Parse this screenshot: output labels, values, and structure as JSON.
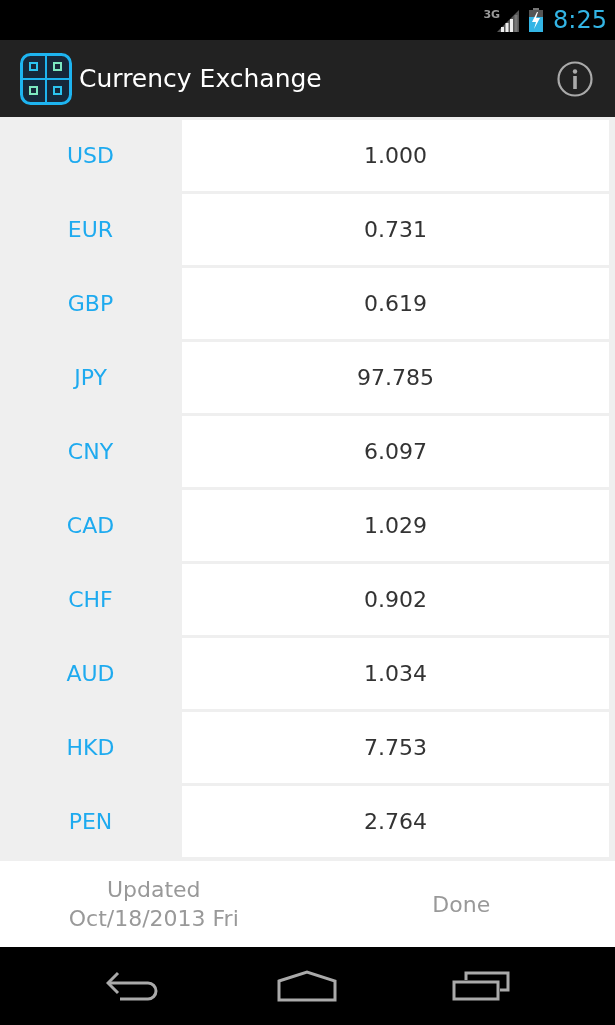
{
  "status_bar": {
    "network": "3G",
    "time": "8:25"
  },
  "action_bar": {
    "title": "Currency Exchange"
  },
  "rates": [
    {
      "code": "USD",
      "value": "1.000"
    },
    {
      "code": "EUR",
      "value": "0.731"
    },
    {
      "code": "GBP",
      "value": "0.619"
    },
    {
      "code": "JPY",
      "value": "97.785"
    },
    {
      "code": "CNY",
      "value": "6.097"
    },
    {
      "code": "CAD",
      "value": "1.029"
    },
    {
      "code": "CHF",
      "value": "0.902"
    },
    {
      "code": "AUD",
      "value": "1.034"
    },
    {
      "code": "HKD",
      "value": "7.753"
    },
    {
      "code": "PEN",
      "value": "2.764"
    }
  ],
  "footer": {
    "updated_lines": [
      "Updated",
      "Oct/18/2013 Fri"
    ],
    "done": "Done"
  }
}
